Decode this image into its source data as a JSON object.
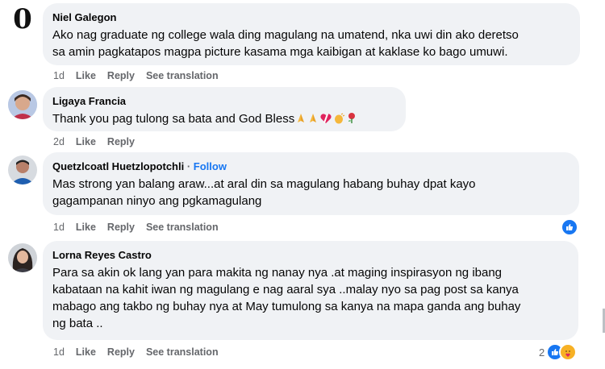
{
  "comments": [
    {
      "author": "Niel Galegon",
      "avatar_letter": "0",
      "lines": [
        "Ako nag graduate ng college wala ding magulang na umatend, nka uwi din ako deretso",
        "sa amin pagkatapos magpa picture kasama mga kaibigan at kaklase ko bago umuwi."
      ],
      "time": "1d",
      "actions": [
        "Like",
        "Reply",
        "See translation"
      ]
    },
    {
      "author": "Ligaya Francia",
      "lines": [
        "Thank you pag tulong sa bata and God Bless"
      ],
      "time": "2d",
      "actions": [
        "Like",
        "Reply"
      ]
    },
    {
      "author": "Quetzlcoatl Huetzlopotchli",
      "separator": " · ",
      "follow": "Follow",
      "lines": [
        "Mas strong yan balang araw...at aral din sa magulang habang buhay dpat kayo",
        "gagampanan ninyo ang pgkamagulang"
      ],
      "time": "1d",
      "actions": [
        "Like",
        "Reply",
        "See translation"
      ]
    },
    {
      "author": "Lorna Reyes Castro",
      "lines": [
        "Para sa akin ok lang yan para makita ng nanay nya .at maging inspirasyon ng ibang",
        "kabataan na kahit iwan ng magulang e nag aaral sya ..malay nyo sa pag post sa kanya",
        "mabago ang takbo ng buhay nya at May tumulong sa kanya na mapa ganda ang buhay",
        "ng bata .."
      ],
      "time": "1d",
      "actions": [
        "Like",
        "Reply",
        "See translation"
      ],
      "reaction_count": "2"
    }
  ],
  "colors": {
    "bubble": "#f0f2f5",
    "meta": "#65676b",
    "link": "#1877f2",
    "like": "#1877f2",
    "care": "#f7b125"
  },
  "icons": [
    "pray-emoji",
    "heart-emoji",
    "clap-emoji",
    "rose-emoji",
    "like-reaction-icon",
    "care-reaction-icon"
  ]
}
